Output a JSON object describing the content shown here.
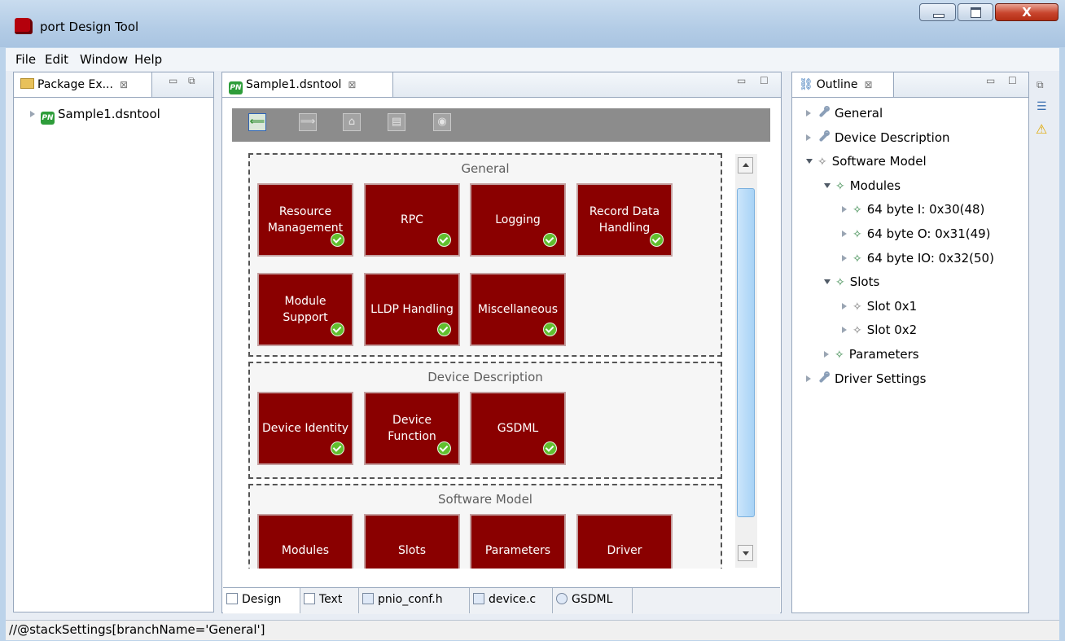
{
  "window": {
    "title": "port Design Tool",
    "close_glyph": "X"
  },
  "menubar": {
    "items": [
      "File",
      "Edit",
      "Window",
      "Help"
    ]
  },
  "package_explorer": {
    "tab_label": "Package Ex...",
    "tree": [
      {
        "label": "Sample1.dsntool",
        "badge": "PN"
      }
    ]
  },
  "editor": {
    "tab_label": "Sample1.dsntool",
    "tab_badge": "PN",
    "toolbar": [
      "back",
      "forward",
      "home",
      "save",
      "help"
    ],
    "sections": [
      {
        "title": "General",
        "tiles": [
          {
            "label": "Resource Management",
            "check": true
          },
          {
            "label": "RPC",
            "check": true
          },
          {
            "label": "Logging",
            "check": true
          },
          {
            "label": "Record Data Handling",
            "check": true
          },
          {
            "label": "Module Support",
            "check": true
          },
          {
            "label": "LLDP Handling",
            "check": true
          },
          {
            "label": "Miscellaneous",
            "check": true
          }
        ]
      },
      {
        "title": "Device Description",
        "tiles": [
          {
            "label": "Device Identity",
            "check": true
          },
          {
            "label": "Device Function",
            "check": true
          },
          {
            "label": "GSDML",
            "check": true
          }
        ]
      },
      {
        "title": "Software Model",
        "tiles": [
          {
            "label": "Modules",
            "check": false
          },
          {
            "label": "Slots",
            "check": false
          },
          {
            "label": "Parameters",
            "check": false
          },
          {
            "label": "Driver",
            "check": false
          }
        ]
      }
    ],
    "bottom_tabs": [
      "Design",
      "Text",
      "pnio_conf.h",
      "device.c",
      "GSDML"
    ]
  },
  "outline": {
    "tab_label": "Outline",
    "items": [
      {
        "label": "General",
        "icon": "wrench-icon",
        "expand": "collapsed"
      },
      {
        "label": "Device Description",
        "icon": "wrench-icon",
        "expand": "collapsed"
      },
      {
        "label": "Software Model",
        "icon": "star-gray-icon",
        "expand": "expanded"
      },
      {
        "label": "Modules",
        "icon": "star-green-icon",
        "expand": "expanded"
      },
      {
        "label": "64 byte I: 0x30(48)",
        "icon": "star-green-icon",
        "expand": "collapsed"
      },
      {
        "label": "64 byte O: 0x31(49)",
        "icon": "star-green-icon",
        "expand": "collapsed"
      },
      {
        "label": "64 byte IO: 0x32(50)",
        "icon": "star-green-icon",
        "expand": "collapsed"
      },
      {
        "label": "Slots",
        "icon": "star-green-icon",
        "expand": "expanded"
      },
      {
        "label": "Slot 0x1",
        "icon": "star-gray-icon",
        "expand": "collapsed"
      },
      {
        "label": "Slot 0x2",
        "icon": "star-gray-icon",
        "expand": "collapsed"
      },
      {
        "label": "Parameters",
        "icon": "star-green-icon",
        "expand": "collapsed"
      },
      {
        "label": "Driver Settings",
        "icon": "wrench-icon",
        "expand": "collapsed"
      }
    ]
  },
  "statusbar": {
    "text": "//@stackSettings[branchName='General']"
  },
  "colors": {
    "tile": "#8a0000",
    "check": "#61bf2e",
    "accent": "#2e9d3a"
  }
}
